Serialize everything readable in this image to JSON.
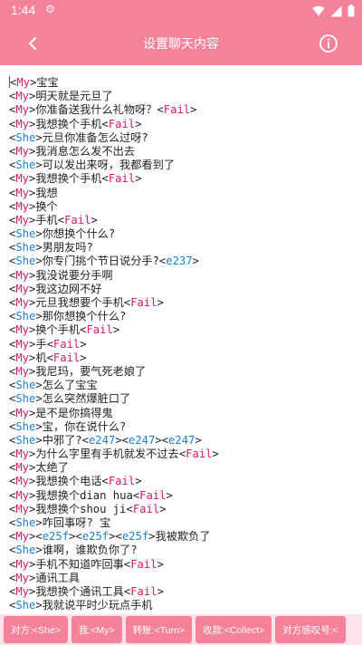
{
  "status_bar": {
    "time": "1:44",
    "icons": [
      "settings-gear-icon",
      "wifi-icon",
      "signal-icon",
      "battery-icon"
    ]
  },
  "header": {
    "title": "设置聊天内容",
    "back_icon": "chevron-left-icon",
    "info_icon": "info-circle-icon"
  },
  "colors": {
    "accent": "#f5829b",
    "bottom_bar_bg": "#fde3e9",
    "speaker_my": "#d41a6b",
    "speaker_she": "#1a7fd6",
    "tag_fail": "#d41a6b",
    "tag_code": "#1a7fd6"
  },
  "chat_lines": [
    {
      "speaker": "My",
      "parts": [
        {
          "t": "宝宝"
        }
      ]
    },
    {
      "speaker": "My",
      "parts": [
        {
          "t": "明天就是元旦了"
        }
      ]
    },
    {
      "speaker": "My",
      "parts": [
        {
          "t": "你准备送我什么礼物呀？"
        },
        {
          "tag": "Fail"
        }
      ]
    },
    {
      "speaker": "My",
      "parts": [
        {
          "t": "我想换个手机"
        },
        {
          "tag": "Fail"
        }
      ]
    },
    {
      "speaker": "She",
      "parts": [
        {
          "t": "元旦你准备怎么过呀?"
        }
      ]
    },
    {
      "speaker": "My",
      "parts": [
        {
          "t": "我消息怎么发不出去"
        }
      ]
    },
    {
      "speaker": "She",
      "parts": [
        {
          "t": "可以发出来呀，我都看到了"
        }
      ]
    },
    {
      "speaker": "My",
      "parts": [
        {
          "t": "我想换个手机"
        },
        {
          "tag": "Fail"
        }
      ]
    },
    {
      "speaker": "My",
      "parts": [
        {
          "t": "我想"
        }
      ]
    },
    {
      "speaker": "My",
      "parts": [
        {
          "t": "换个"
        }
      ]
    },
    {
      "speaker": "My",
      "parts": [
        {
          "t": "手机"
        },
        {
          "tag": "Fail"
        }
      ]
    },
    {
      "speaker": "She",
      "parts": [
        {
          "t": "你想换个什么?"
        }
      ]
    },
    {
      "speaker": "She",
      "parts": [
        {
          "t": "男朋友吗?"
        }
      ]
    },
    {
      "speaker": "She",
      "parts": [
        {
          "t": "你专门挑个节日说分手?"
        },
        {
          "tag": "e237"
        }
      ]
    },
    {
      "speaker": "My",
      "parts": [
        {
          "t": "我没说要分手啊"
        }
      ]
    },
    {
      "speaker": "My",
      "parts": [
        {
          "t": "我这边网不好"
        }
      ]
    },
    {
      "speaker": "My",
      "parts": [
        {
          "t": "元旦我想要个手机"
        },
        {
          "tag": "Fail"
        }
      ]
    },
    {
      "speaker": "She",
      "parts": [
        {
          "t": "那你想换个什么?"
        }
      ]
    },
    {
      "speaker": "My",
      "parts": [
        {
          "t": "换个手机"
        },
        {
          "tag": "Fail"
        }
      ]
    },
    {
      "speaker": "My",
      "parts": [
        {
          "t": "手"
        },
        {
          "tag": "Fail"
        }
      ]
    },
    {
      "speaker": "My",
      "parts": [
        {
          "t": "机"
        },
        {
          "tag": "Fail"
        }
      ]
    },
    {
      "speaker": "My",
      "parts": [
        {
          "t": "我尼玛，要气死老娘了"
        }
      ]
    },
    {
      "speaker": "She",
      "parts": [
        {
          "t": "怎么了宝宝"
        }
      ]
    },
    {
      "speaker": "She",
      "parts": [
        {
          "t": "怎么突然爆脏口了"
        }
      ]
    },
    {
      "speaker": "My",
      "parts": [
        {
          "t": "是不是你搞得鬼"
        }
      ]
    },
    {
      "speaker": "She",
      "parts": [
        {
          "t": "宝，你在说什么?"
        }
      ]
    },
    {
      "speaker": "She",
      "parts": [
        {
          "t": "中邪了?"
        },
        {
          "tag": "e247"
        },
        {
          "tag": "e247"
        },
        {
          "tag": "e247"
        }
      ]
    },
    {
      "speaker": "My",
      "parts": [
        {
          "t": "为什么字里有手机就发不过去"
        },
        {
          "tag": "Fail"
        }
      ]
    },
    {
      "speaker": "My",
      "parts": [
        {
          "t": "太绝了"
        }
      ]
    },
    {
      "speaker": "My",
      "parts": [
        {
          "t": "我想换个电话"
        },
        {
          "tag": "Fail"
        }
      ]
    },
    {
      "speaker": "My",
      "parts": [
        {
          "t": "我想换个dian hua"
        },
        {
          "tag": "Fail"
        }
      ]
    },
    {
      "speaker": "My",
      "parts": [
        {
          "t": "我想换个shou ji"
        },
        {
          "tag": "Fail"
        }
      ]
    },
    {
      "speaker": "She",
      "parts": [
        {
          "t": "咋回事呀? 宝"
        }
      ]
    },
    {
      "speaker": "My",
      "parts": [
        {
          "tag": "e25f"
        },
        {
          "tag": "e25f"
        },
        {
          "tag": "e25f"
        },
        {
          "t": "我被欺负了"
        }
      ]
    },
    {
      "speaker": "She",
      "parts": [
        {
          "t": "谁啊，谁欺负你了?"
        }
      ]
    },
    {
      "speaker": "My",
      "parts": [
        {
          "t": "手机不知道咋回事"
        },
        {
          "tag": "Fail"
        }
      ]
    },
    {
      "speaker": "My",
      "parts": [
        {
          "t": "通讯工具"
        }
      ]
    },
    {
      "speaker": "My",
      "parts": [
        {
          "t": "我想换个通讯工具"
        },
        {
          "tag": "Fail"
        }
      ]
    },
    {
      "speaker": "She",
      "parts": [
        {
          "t": "我就说平时少玩点手机"
        }
      ]
    }
  ],
  "bottom_bar": {
    "chips": [
      {
        "label": "对方:<She>",
        "name": "insert-she-button"
      },
      {
        "label": "我:<My>",
        "name": "insert-my-button"
      },
      {
        "label": "转账:<Turn>",
        "name": "insert-turn-button"
      },
      {
        "label": "收款:<Collect>",
        "name": "insert-collect-button"
      },
      {
        "label": "对方感叹号:<",
        "name": "insert-exclamation-button"
      }
    ]
  }
}
